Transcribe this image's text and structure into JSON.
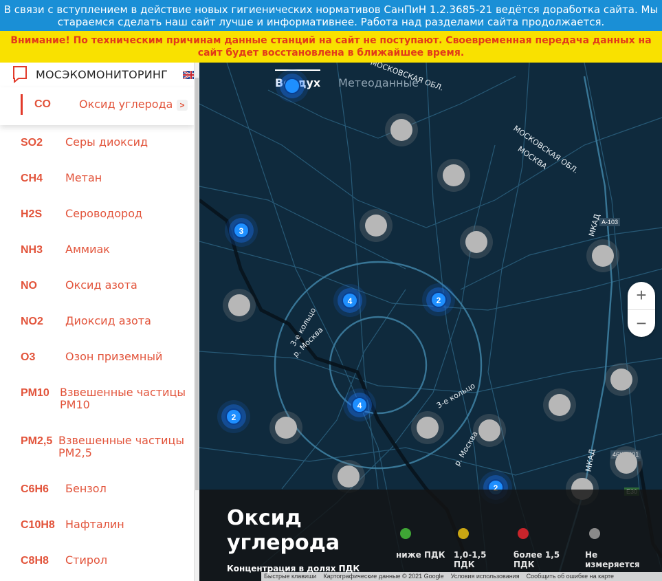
{
  "banners": {
    "notice_blue": "В связи с вступлением в действие новых гигиенических нормативов СанПиН 1.2.3685-21 ведётся доработка сайта. Мы стараемся сделать наш сайт лучше и информативнее. Работа над разделами сайта продолжается.",
    "notice_yellow": "Внимание! По техническим причинам данные станций на сайт не поступают. Своевременная передача данных на сайт будет восстановлена в ближайшее время."
  },
  "brand": {
    "name": "МОСЭКОМОНИТОРИНГ",
    "logo_icon": "speech-bubble-icon",
    "language_icon": "uk-flag-icon"
  },
  "sidebar": {
    "active": {
      "code": "CO",
      "name": "Оксид углерода",
      "chevron": ">"
    },
    "items": [
      {
        "code": "SO2",
        "name": "Серы диоксид"
      },
      {
        "code": "CH4",
        "name": "Метан"
      },
      {
        "code": "H2S",
        "name": "Сероводород"
      },
      {
        "code": "NH3",
        "name": "Аммиак"
      },
      {
        "code": "NO",
        "name": "Оксид азота"
      },
      {
        "code": "NO2",
        "name": "Диоксид азота"
      },
      {
        "code": "O3",
        "name": "Озон приземный"
      },
      {
        "code": "PM10",
        "name": "Взвешенные частицы PM10"
      },
      {
        "code": "PM2,5",
        "name": "Взвешенные частицы PM2,5"
      },
      {
        "code": "C6H6",
        "name": "Бензол"
      },
      {
        "code": "C10H8",
        "name": "Нафталин"
      },
      {
        "code": "C8H8",
        "name": "Стирол"
      }
    ]
  },
  "map": {
    "tabs": [
      {
        "label": "Воздух"
      },
      {
        "label": "Метеоданные"
      }
    ],
    "zoom": {
      "in": "+",
      "out": "−"
    },
    "clusters": [
      {
        "count": "3"
      },
      {
        "count": "4"
      },
      {
        "count": "2"
      },
      {
        "count": "4"
      },
      {
        "count": "2"
      },
      {
        "count": "2"
      }
    ],
    "labels": {
      "moscow_obl_1": "МОСКОВСКАЯ ОБЛ.",
      "moscow_obl_2": "МОСКОВСКАЯ ОБЛ.",
      "moscow": "МОСКВА",
      "mkad_1": "МКАД",
      "mkad_2": "МКАД",
      "ring3_1": "3-е кольцо",
      "ring3_2": "3-е кольцо",
      "river_1": "р. Москва",
      "river_2": "р. Москва",
      "a103": "А-103",
      "road_46": "46К-0001",
      "e30": "E30"
    }
  },
  "legend": {
    "title": "Оксид углерода",
    "subtitle": "Концентрация в долях ПДК",
    "items": [
      {
        "label": "ниже ПДК",
        "color": "#3fa535"
      },
      {
        "label": "1,0-1,5 ПДК",
        "color": "#c9a613"
      },
      {
        "label": "более 1,5 ПДК",
        "color": "#c8242b"
      },
      {
        "label": "Не измеряется",
        "color": "#8a8a8a"
      }
    ]
  },
  "attribution": {
    "items": [
      "Быстрые клавиши",
      "Картографические данные © 2021 Google",
      "Условия использования",
      "Сообщить об ошибке на карте"
    ]
  }
}
